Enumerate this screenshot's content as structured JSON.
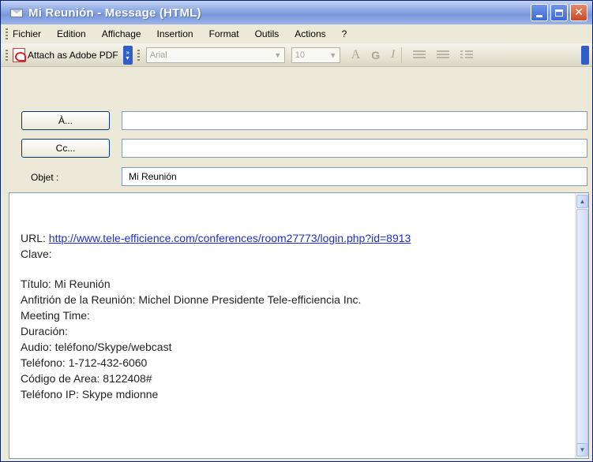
{
  "window": {
    "title": "Mi Reunión - Message (HTML)"
  },
  "menu": [
    "Fichier",
    "Edition",
    "Affichage",
    "Insertion",
    "Format",
    "Outils",
    "Actions",
    "?"
  ],
  "toolbar": {
    "pdf_label": "Attach as Adobe PDF",
    "font": "Arial",
    "size": "10",
    "fmt_a": "A",
    "fmt_bold": "G",
    "fmt_italic": "I"
  },
  "header": {
    "to_button": "À...",
    "cc_button": "Cc...",
    "to_value": "",
    "cc_value": "",
    "subject_label": "Objet :",
    "subject_value": "Mi Reunión"
  },
  "body": {
    "url_label": "URL: ",
    "url": "http://www.tele-efficience.com/conferences/room27773/login.php?id=8913",
    "clave": "Clave:",
    "titulo": "Título: Mi Reunión",
    "anfitrion": "Anfitrión de la Reunión: Michel Dionne Presidente Tele-efficiencia Inc.",
    "meeting_time": "Meeting Time:",
    "duracion": "Duración:",
    "audio": "Audio: teléfono/Skype/webcast",
    "telefono": "Teléfono: 1-712-432-6060",
    "codigo": "Código de Area: 8122408#",
    "telefono_ip": "Teléfono IP: Skype mdionne"
  },
  "colors": {
    "titlebar": "#8ea9e5",
    "link": "#1f2fd0",
    "chrome": "#ece9d8"
  }
}
